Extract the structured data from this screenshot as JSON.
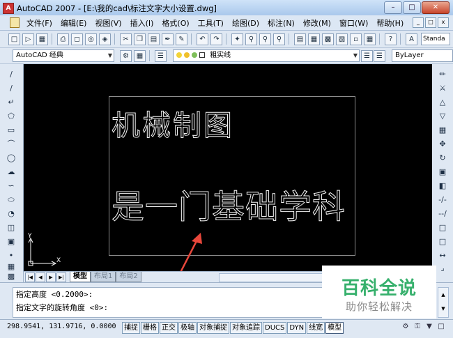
{
  "window": {
    "title": "AutoCAD 2007 - [E:\\我的cad\\标注文字大小设置.dwg]",
    "app_icon_text": "A",
    "controls": [
      "minimize",
      "maximize",
      "close"
    ]
  },
  "menu": {
    "items": [
      "文件(F)",
      "编辑(E)",
      "视图(V)",
      "插入(I)",
      "格式(O)",
      "工具(T)",
      "绘图(D)",
      "标注(N)",
      "修改(M)",
      "窗口(W)",
      "帮助(H)"
    ]
  },
  "toolbar": {
    "text_style": "Standa",
    "workspace": "AutoCAD 经典",
    "layer": "粗实线",
    "linetype": "ByLayer"
  },
  "drawing": {
    "line1": "机械制图",
    "line2": "是一门基础学科",
    "ucs_y": "Y",
    "ucs_x": "X",
    "annotation_arrow_color": "#e8473b"
  },
  "layout_tabs": {
    "tabs": [
      "模型",
      "布局1",
      "布局2"
    ],
    "active": "模型"
  },
  "command": {
    "lines": [
      "指定高度 <0.2000>:",
      "指定文字的旋转角度 <0>:"
    ]
  },
  "status": {
    "coords": "298.9541, 131.9716, 0.0000",
    "modes": [
      "捕捉",
      "栅格",
      "正交",
      "极轴",
      "对象捕捉",
      "对象追踪",
      "DUCS",
      "DYN",
      "线宽",
      "模型"
    ],
    "modes_on": [
      "模型"
    ]
  },
  "watermark": {
    "title": "百科全说",
    "subtitle": "助你轻松解决",
    "color": "#36b06c"
  }
}
